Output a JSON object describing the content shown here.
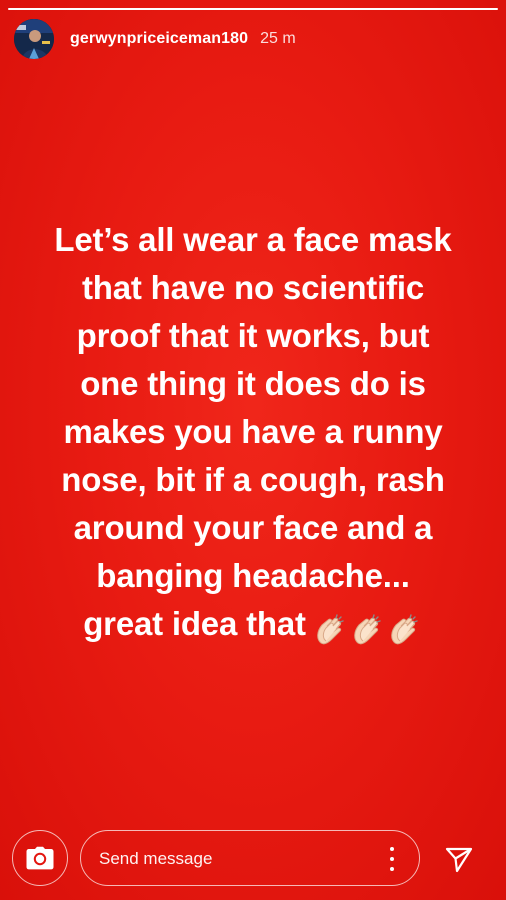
{
  "story": {
    "background_color": "#e3150f",
    "progress_fraction": 1.0,
    "user": {
      "username": "gerwynpriceiceman180",
      "time_ago": "25 m",
      "avatar_icon": "profile-photo"
    },
    "text_lines": [
      "Let’s all wear a face mask",
      "that have no scientific",
      "proof that it works, but",
      "one thing it does do is",
      "makes you have a runny",
      "nose, bit if a cough, rash",
      "around your face and a",
      "banging headache...",
      "great idea that"
    ],
    "emoji": [
      "clapping-hands",
      "clapping-hands",
      "clapping-hands"
    ]
  },
  "footer": {
    "camera_icon": "camera-icon",
    "message_placeholder": "Send message",
    "more_icon": "more-vertical-icon",
    "send_icon": "send-icon"
  }
}
